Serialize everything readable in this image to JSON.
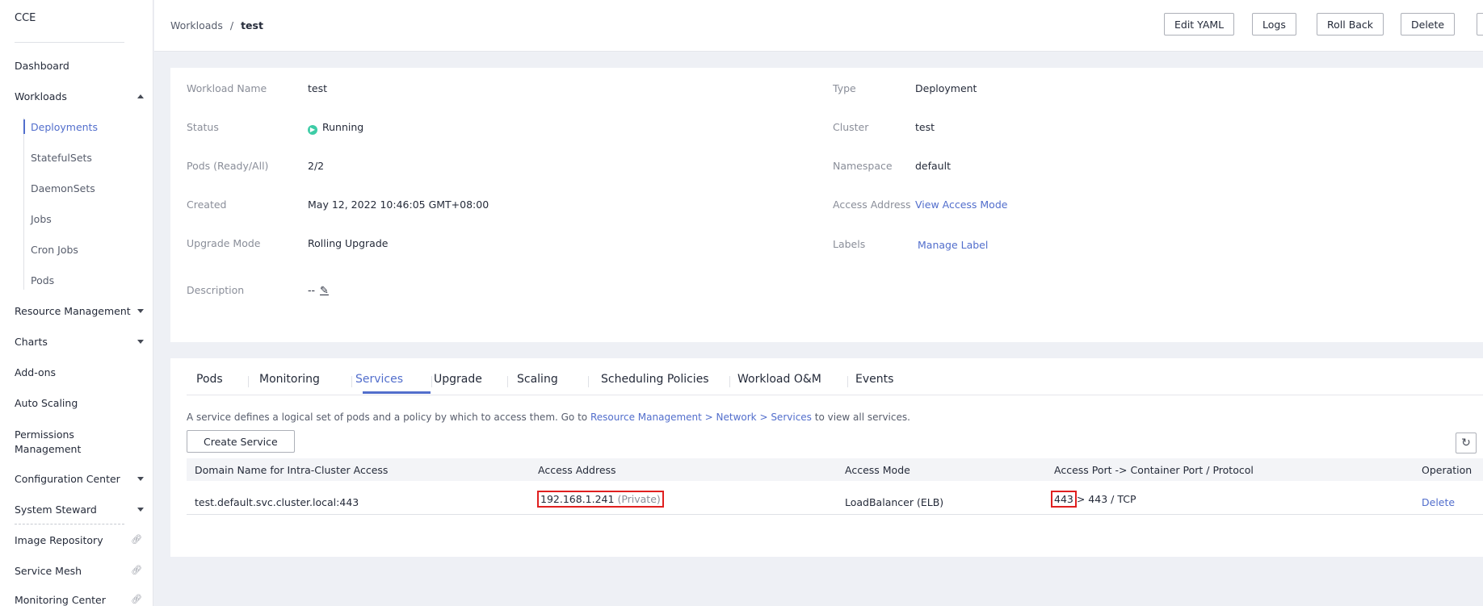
{
  "sidebar": {
    "brand": "CCE",
    "items": [
      {
        "label": "Dashboard"
      },
      {
        "label": "Workloads"
      },
      {
        "label": "Resource Management"
      },
      {
        "label": "Charts"
      },
      {
        "label": "Add-ons"
      },
      {
        "label": "Auto Scaling"
      },
      {
        "label": "Permissions\nManagement"
      },
      {
        "label": "Configuration Center"
      },
      {
        "label": "System Steward"
      },
      {
        "label": "Image Repository"
      },
      {
        "label": "Service Mesh"
      },
      {
        "label": "Monitoring Center"
      }
    ],
    "workloads_sub": [
      "Deployments",
      "StatefulSets",
      "DaemonSets",
      "Jobs",
      "Cron Jobs",
      "Pods"
    ]
  },
  "header": {
    "breadcrumb_parent": "Workloads",
    "breadcrumb_sep": "/",
    "breadcrumb_current": "test",
    "buttons": [
      "Edit YAML",
      "Logs",
      "Roll Back",
      "Delete"
    ]
  },
  "details": {
    "left": [
      {
        "label": "Workload Name",
        "value": "test"
      },
      {
        "label": "Status",
        "value": "Running"
      },
      {
        "label": "Pods (Ready/All)",
        "value": "2/2"
      },
      {
        "label": "Created",
        "value": "May 12, 2022 10:46:05 GMT+08:00"
      },
      {
        "label": "Upgrade Mode",
        "value": "Rolling Upgrade"
      },
      {
        "label": "Description",
        "value": "--"
      }
    ],
    "right": [
      {
        "label": "Type",
        "value": "Deployment"
      },
      {
        "label": "Cluster",
        "value": "test"
      },
      {
        "label": "Namespace",
        "value": "default"
      },
      {
        "label": "Access Address",
        "value": "View Access Mode"
      },
      {
        "label": "Labels",
        "value": "Manage Label"
      }
    ]
  },
  "tabs": [
    "Pods",
    "Monitoring",
    "Services",
    "Upgrade",
    "Scaling",
    "Scheduling Policies",
    "Workload O&M",
    "Events"
  ],
  "active_tab": "Services",
  "services": {
    "intro_before": "A service defines a logical set of pods and a policy by which to access them. Go to ",
    "intro_link": "Resource Management > Network > Services",
    "intro_after": " to view all services.",
    "create_label": "Create Service",
    "columns": [
      "Domain Name for Intra-Cluster Access",
      "Access Address",
      "Access Mode",
      "Access Port -> Container Port / Protocol",
      "Operation"
    ],
    "rows": [
      {
        "domain": "test.default.svc.cluster.local:443",
        "address_ip": "192.168.1.241",
        "address_type": "(Private)",
        "mode": "LoadBalancer (ELB)",
        "access_port": "443",
        "port_rest": "> 443 / TCP",
        "operation": "Delete"
      }
    ]
  },
  "colors": {
    "accent": "#526ecc",
    "running": "#3dcca6",
    "highlight": "#e02020"
  }
}
